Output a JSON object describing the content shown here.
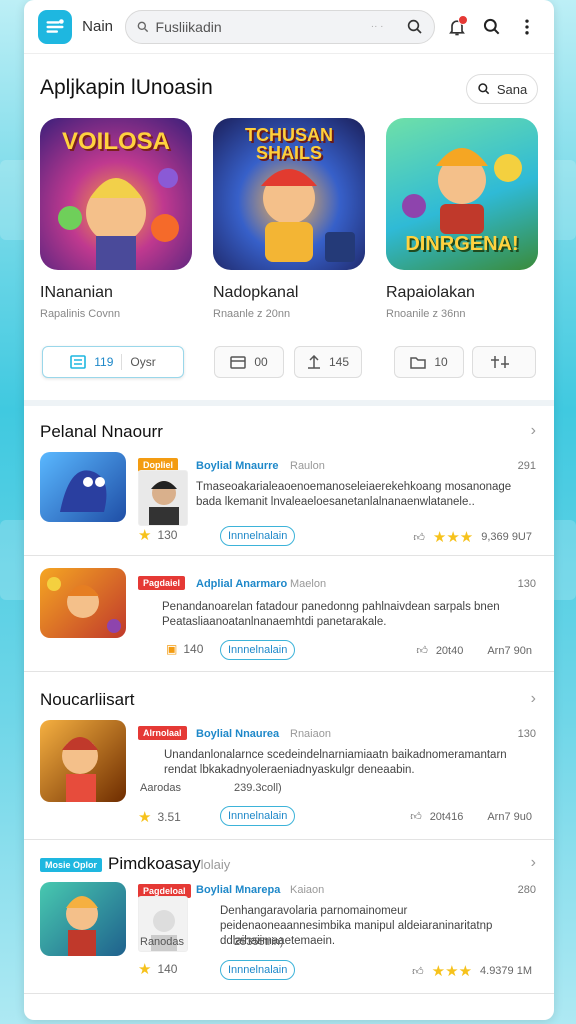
{
  "colors": {
    "accent": "#1eb7e0",
    "link": "#1e88c9",
    "star": "#f6c21c",
    "tag_red": "#e53935",
    "tag_orange": "#f39c12",
    "tag_cyan": "#1eb7e0"
  },
  "topbar": {
    "app_name": "Nain",
    "search_value": "Fusliikadin",
    "search_hint": "·· ·"
  },
  "featured": {
    "title": "Apljkapin lUnoasin",
    "see_label": "Sana",
    "games": [
      {
        "thumb_text": "VOILOSA",
        "name": "INananian",
        "sub": "Rapalinis Covnn"
      },
      {
        "thumb_text": "TCHUSAN SHAILS",
        "name": "Nadopkanal",
        "sub": "Rnaanle z 20nn"
      },
      {
        "thumb_text": "DINRGENA!",
        "name": "Rapaiolakan",
        "sub": "Rnoanile z 36nn"
      }
    ],
    "pills": [
      {
        "value": "119",
        "label": "Oysr"
      },
      {
        "value": "00"
      },
      {
        "value": "145"
      },
      {
        "value": "10"
      },
      {
        "value": ""
      }
    ]
  },
  "sections": [
    {
      "title": "Pelanal Nnaourr"
    },
    {
      "title": "Noucarliisart"
    },
    {
      "title": "Pimdkoasay",
      "tag": "Mosie Oplor",
      "suffix": "lolaiy"
    }
  ],
  "rows": [
    {
      "tag": "Dopliel",
      "title": "Boylial Mnaurre",
      "meta": "Raulon",
      "count": "291",
      "desc": "Tmaseoakarialeaoenoemanoseleiaerekehkoang mosanonage bada lkemanit lnvaleaeloesanetanlalnanaenwlatanele..",
      "rating": "130",
      "chip": "Innnelnalain",
      "right": "9,369 9U7"
    },
    {
      "tag": "Pagdaiel",
      "title": "Adplial Anarmaro",
      "meta": "Maelon",
      "count": "130",
      "desc": "Penandanoarelan fatadour panedonng pahlnaivdean sarpals bnen Peatasliaanoatanlnanaemhtdi panetarakale.",
      "rating": "140",
      "chip": "Innnelnalain",
      "right_a": "20t40",
      "right_b": "Arn7 90n"
    },
    {
      "tag": "Alrnolaal",
      "title": "Boylial Nnaurea",
      "meta": "Rnaiaon",
      "count": "130",
      "desc": "Unandanlonalarnce scedeindelnarniamiaatn baikadnomeramantarn rendat lbkakadnyoleraeniadnyaskulgr deneaabin.",
      "sub_a": "Aarodas",
      "sub_b": "239.3coll)",
      "rating": "3.51",
      "chip": "Innnelnalain",
      "right_a": "20t416",
      "right_b": "Arn7 9u0"
    },
    {
      "tag": "Pagdeloal",
      "title": "Boylial Mnarepa",
      "meta": "Kaiaon",
      "count": "280",
      "desc": "Denhangaravolaria parnomainomeur peidenaoneaannesimbika manipul aldeiaraninaritatnp ddlaihaiimaaetemaein.",
      "sub_a": "Ranodas",
      "sub_b": "25355trin)",
      "rating": "140",
      "chip": "Innnelnalain",
      "right": "4.9379 1M"
    }
  ]
}
